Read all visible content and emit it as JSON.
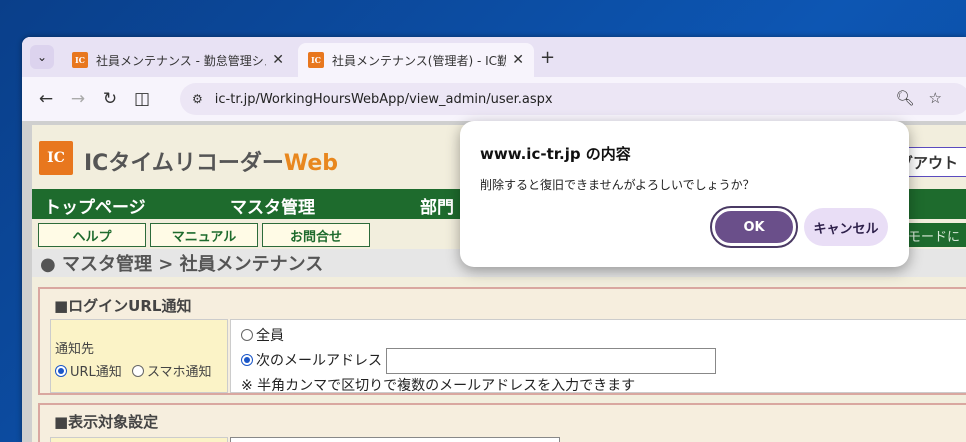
{
  "browser": {
    "tabs": [
      {
        "title": "社員メンテナンス - 勤怠管理システ",
        "favicon": "IC",
        "active": false
      },
      {
        "title": "社員メンテナンス(管理者) - IC勤怠",
        "favicon": "IC",
        "active": true
      }
    ],
    "url": "ic-tr.jp/WorkingHoursWebApp/view_admin/user.aspx",
    "icons": {
      "tab_menu": "chevron-down-icon",
      "close": "close-icon",
      "new_tab": "plus-icon",
      "back": "arrow-left-icon",
      "forward": "arrow-right-icon",
      "reload": "reload-icon",
      "split": "split-view-icon",
      "site_info": "tune-icon",
      "zoom": "zoom-icon",
      "bookmark": "star-icon"
    }
  },
  "app": {
    "logo_mark": "IC",
    "logo_text": "ICタイムリコーダー",
    "logo_web": "Web",
    "logout_label": "グアウト",
    "nav": [
      "トップページ",
      "マスタ管理",
      "部門"
    ],
    "subnav": [
      "ヘルプ",
      "マニュアル",
      "お問合せ"
    ],
    "mode_label": "ーモードに",
    "breadcrumb": "● マスタ管理 > 社員メンテナンス",
    "login_section": {
      "title": "■ログインURL通知",
      "label": "通知先",
      "opt_url": "URL通知",
      "opt_smart": "スマホ通知",
      "opt_all": "全員",
      "opt_mail": "次のメールアドレス",
      "mail_value": "",
      "hint": "※ 半角カンマで区切りで複数のメールアドレスを入力できます"
    },
    "display_section": {
      "title": "■表示対象設定"
    }
  },
  "dialog": {
    "title": "www.ic-tr.jp の内容",
    "message": "削除すると復旧できませんがよろしいでしょうか？",
    "ok_label": "OK",
    "cancel_label": "キャンセル"
  },
  "colors": {
    "accent_orange": "#e8771e",
    "nav_green": "#1e6b2d",
    "ok_button": "#6a4f8a",
    "cancel_button": "#e9def6"
  }
}
